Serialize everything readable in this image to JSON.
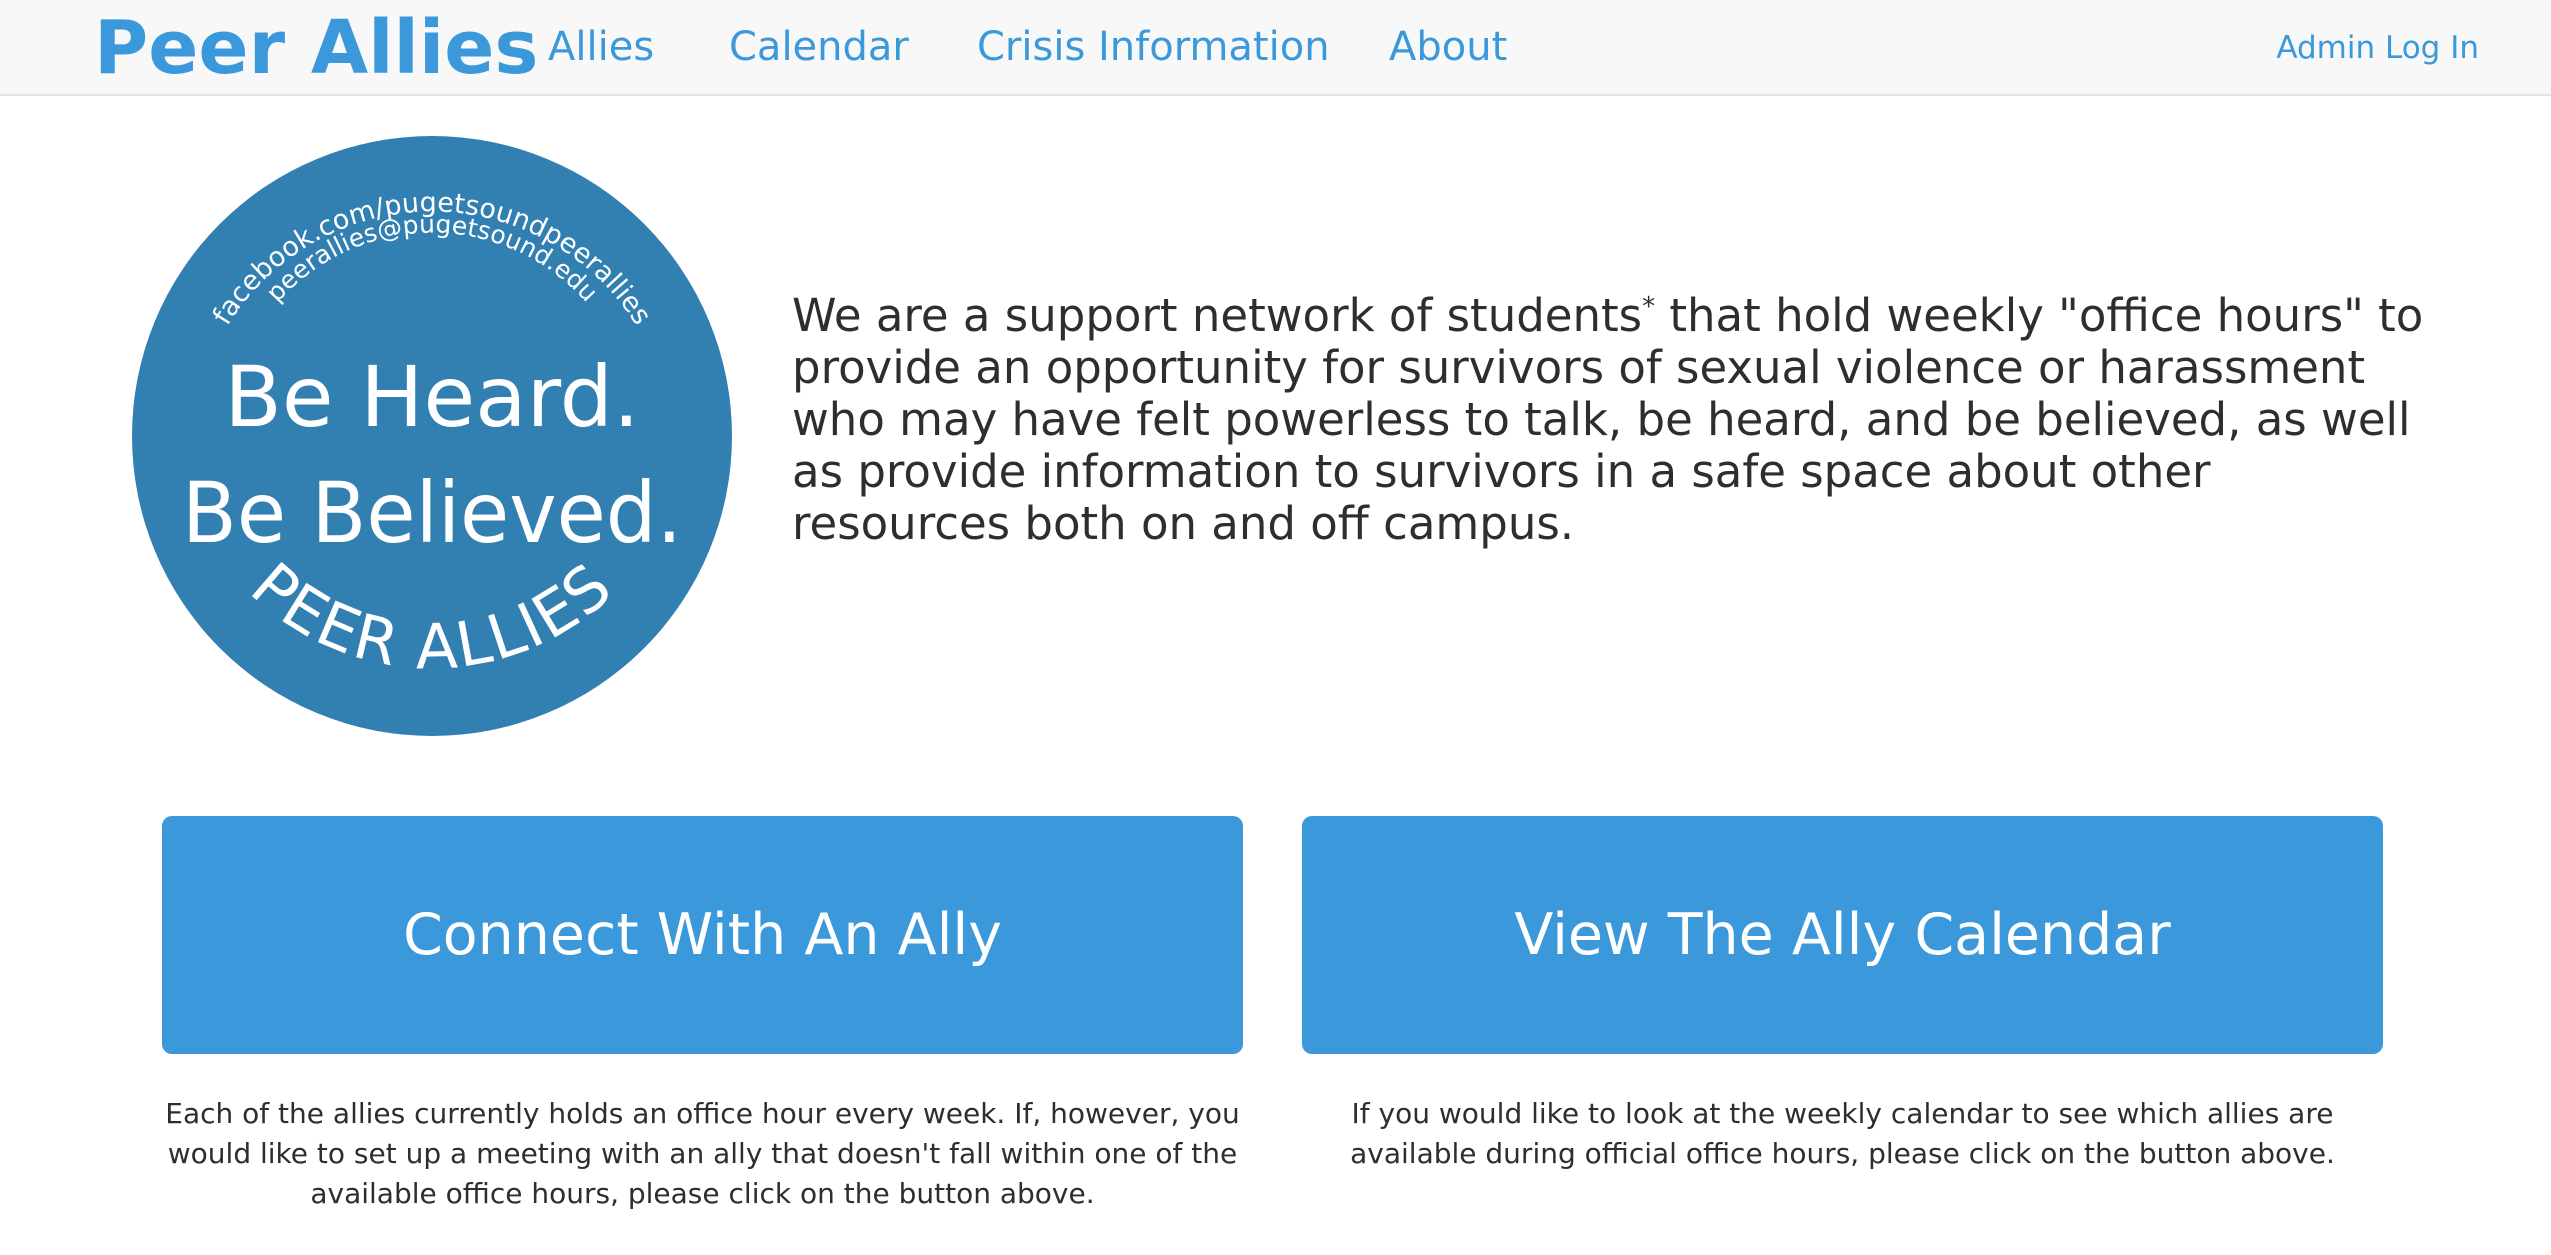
{
  "navbar": {
    "brand": "Peer Allies",
    "links": [
      {
        "label": "Allies"
      },
      {
        "label": "Calendar"
      },
      {
        "label": "Crisis Information"
      },
      {
        "label": "About"
      }
    ],
    "admin_login": "Admin Log In"
  },
  "seal": {
    "facebook": "facebook.com/pugetsoundpeerallies",
    "email": "peerallies@pugetsound.edu",
    "line1": "Be Heard.",
    "line2": "Be Believed.",
    "bottom": "PEER ALLIES",
    "color": "#327fb2"
  },
  "intro": {
    "before_mark": "We are a support network of students",
    "mark": "*",
    "after_mark": " that hold weekly \"office hours\" to provide an opportunity for survivors of sexual violence or harassment who may have felt powerless to talk, be heard, and be believed, as well as provide information to survivors in a safe space about other resources both on and off campus."
  },
  "actions": {
    "connect": {
      "label": "Connect With An Ally",
      "description": "Each of the allies currently holds an office hour every week. If, however, you would like to set up a meeting with an ally that doesn't fall within one of the available office hours, please click on the button above."
    },
    "calendar": {
      "label": "View The Ally Calendar",
      "description": "If you would like to look at the weekly calendar to see which allies are available during official office hours, please click on the button above."
    }
  },
  "colors": {
    "accent": "#3b99db",
    "seal": "#327fb2",
    "navbar_bg": "#f8f8f8",
    "text": "#2e2e2e"
  }
}
